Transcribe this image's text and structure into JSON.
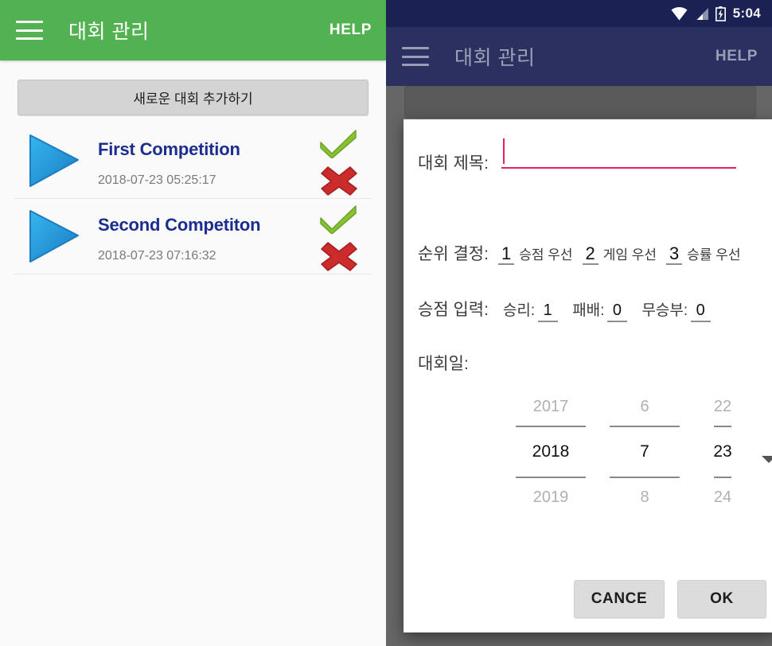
{
  "left": {
    "appbar": {
      "menu_icon": "hamburger-menu-icon",
      "title": "대회 관리",
      "help_label": "HELP"
    },
    "add_button_label": "새로운 대회 추가하기",
    "competitions": [
      {
        "name": "First Competition",
        "date": "2018-07-23 05:25:17",
        "play_icon": "play-triangle-icon",
        "confirm_icon": "green-check-icon",
        "delete_icon": "red-cross-icon"
      },
      {
        "name": "Second Competiton",
        "date": "2018-07-23 07:16:32",
        "play_icon": "play-triangle-icon",
        "confirm_icon": "green-check-icon",
        "delete_icon": "red-cross-icon"
      }
    ]
  },
  "right": {
    "statusbar": {
      "wifi_icon": "wifi-icon",
      "signal_icon": "cell-signal-icon",
      "battery_icon": "battery-charging-icon",
      "time": "5:04"
    },
    "appbar": {
      "menu_icon": "hamburger-menu-icon",
      "title": "대회 관리",
      "help_label": "HELP"
    },
    "dialog": {
      "title_field": {
        "label": "대회 제목:",
        "value": "",
        "placeholder": ""
      },
      "rank_field": {
        "label": "순위 결정:",
        "options": [
          {
            "num": "1",
            "text": "승점 우선"
          },
          {
            "num": "2",
            "text": "게임 우선"
          },
          {
            "num": "3",
            "text": "승률 우선"
          }
        ]
      },
      "points_field": {
        "label": "승점 입력:",
        "items": [
          {
            "label": "승리:",
            "value": "1"
          },
          {
            "label": "패배:",
            "value": "0"
          },
          {
            "label": "무승부:",
            "value": "0"
          }
        ]
      },
      "date_field": {
        "label": "대회일:",
        "year": {
          "prev": "2017",
          "selected": "2018",
          "next": "2019"
        },
        "month": {
          "prev": "6",
          "selected": "7",
          "next": "8"
        },
        "day": {
          "prev": "22",
          "selected": "23",
          "next": "24"
        },
        "dropdown_icon": "chevron-down-icon"
      },
      "actions": {
        "cancel_label": "CANCE",
        "ok_label": "OK"
      }
    }
  },
  "colors": {
    "left_appbar_green": "#52b151",
    "right_appbar_navy": "#2b3060",
    "statusbar_navy": "#1b2153",
    "accent_pink": "#e91e63",
    "title_blue": "#1b2d8f",
    "check_green": "#86c232",
    "cross_red": "#c62828",
    "play_blue": "#2aa8e0"
  }
}
